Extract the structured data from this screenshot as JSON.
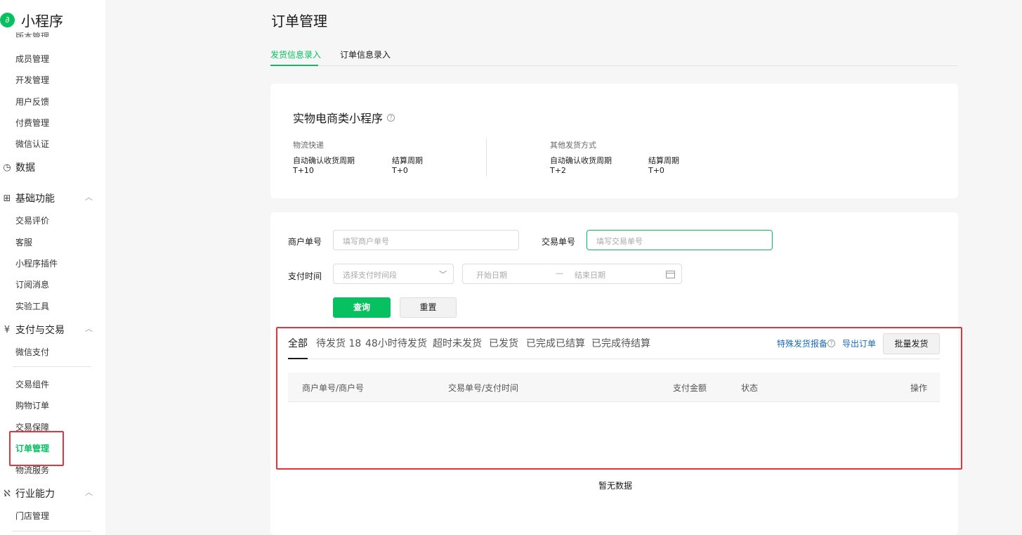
{
  "app": {
    "logo_glyph": "∂",
    "name": "小程序"
  },
  "sidebar": {
    "cut_item": "版本管理",
    "items": [
      {
        "label": "成员管理"
      },
      {
        "label": "开发管理"
      },
      {
        "label": "用户反馈"
      },
      {
        "label": "付费管理"
      },
      {
        "label": "微信认证"
      }
    ],
    "group_data": {
      "icon": "◷",
      "label": "数据"
    },
    "group_basic": {
      "icon": "⊞",
      "label": "基础功能",
      "chevron": "︿"
    },
    "basic_items": [
      {
        "label": "交易评价"
      },
      {
        "label": "客服"
      },
      {
        "label": "小程序插件"
      },
      {
        "label": "订阅消息"
      },
      {
        "label": "实验工具"
      }
    ],
    "group_pay": {
      "icon": "¥",
      "label": "支付与交易",
      "chevron": "︿"
    },
    "pay_items": [
      {
        "label": "微信支付"
      }
    ],
    "trade_items": [
      {
        "label": "交易组件"
      },
      {
        "label": "购物订单"
      },
      {
        "label": "交易保障"
      },
      {
        "label": "订单管理"
      },
      {
        "label": "物流服务"
      }
    ],
    "group_industry": {
      "icon": "ℵ",
      "label": "行业能力",
      "chevron": "︿"
    },
    "industry_items": [
      {
        "label": "门店管理"
      }
    ]
  },
  "header": {
    "title": "订单管理",
    "tabs": [
      {
        "label": "发货信息录入"
      },
      {
        "label": "订单信息录入"
      }
    ]
  },
  "info_card": {
    "title": "实物电商类小程序",
    "help_icon": "?",
    "logistics": {
      "heading": "物流快递",
      "confirm_label": "自动确认收货周期",
      "confirm_value": "T+10",
      "settle_label": "结算周期",
      "settle_value": "T+0"
    },
    "other": {
      "heading": "其他发货方式",
      "confirm_label": "自动确认收货周期",
      "confirm_value": "T+2",
      "settle_label": "结算周期",
      "settle_value": "T+0"
    }
  },
  "filters": {
    "merchant_no_label": "商户单号",
    "merchant_no_placeholder": "填写商户单号",
    "trade_no_label": "交易单号",
    "trade_no_placeholder": "填写交易单号",
    "pay_time_label": "支付时间",
    "pay_time_select": "选择支付时间段",
    "start_date": "开始日期",
    "date_sep": "—",
    "end_date": "结束日期",
    "query_button": "查询",
    "reset_button": "重置"
  },
  "status_tabs": [
    {
      "label": "全部"
    },
    {
      "label": "待发货 18"
    },
    {
      "label": "48小时待发货"
    },
    {
      "label": "超时未发货"
    },
    {
      "label": "已发货"
    },
    {
      "label": "已完成已结算"
    },
    {
      "label": "已完成待结算"
    }
  ],
  "actions": {
    "special_report": "特殊发货报备",
    "export": "导出订单",
    "batch_ship": "批量发货"
  },
  "table": {
    "columns": [
      "商户单号/商户号",
      "交易单号/支付时间",
      "支付金额",
      "状态",
      "操作"
    ],
    "empty": "暂无数据"
  }
}
